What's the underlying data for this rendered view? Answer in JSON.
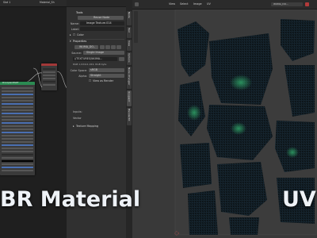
{
  "node_editor": {
    "header_left": "Slot 1",
    "header_mid": "Material_Sh",
    "node_title": "Principled BSDF"
  },
  "properties": {
    "top_tab": "Tools",
    "section_image": "Image",
    "reuse_button": "Reuse Node",
    "name_label": "Name:",
    "name_value": "Image Texture.014",
    "label_label": "Label:",
    "color_label": "Color",
    "properties_section": "Properties",
    "image_name": "WUMA_DO..",
    "source_label": "Source:",
    "source_value": "Single Image",
    "filepath": "//TEXTURES\\WUMA...",
    "info_text": "RGB 1,024x1,024, RGB byte",
    "color_space_label": "Color Space:",
    "color_space_value": "sRGB",
    "alpha_label": "Alpha:",
    "alpha_value": "Straight",
    "view_as_render": "View as Render",
    "inputs_label": "Inputs:",
    "vector_label": "Vector",
    "texture_mapping": "Texture Mapping",
    "vertical_tabs": [
      "Node",
      "Tool",
      "View",
      "Options",
      "Node Wrangler",
      "Ucupaint",
      "BlenderKit"
    ]
  },
  "uv_editor": {
    "menu": [
      "View",
      "Select",
      "Image",
      "UV"
    ],
    "image_name": "WUMA_DO..."
  },
  "overlay": {
    "left_caption": "BR Material",
    "right_caption": "UV"
  },
  "colors": {
    "accent_blue": "#4a6fb1",
    "node_header_red": "#a23838",
    "node_header_green": "#2b8a52",
    "uv_mesh_green": "#2e9d64",
    "uv_bg": "#393939"
  }
}
